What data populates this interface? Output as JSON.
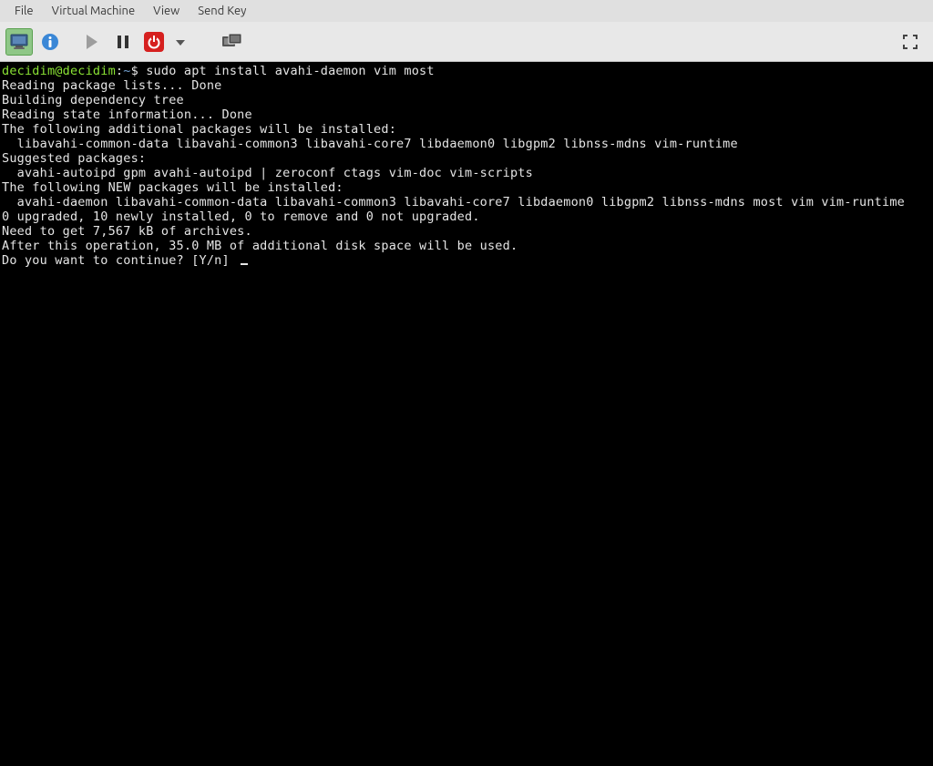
{
  "menubar": {
    "items": [
      "File",
      "Virtual Machine",
      "View",
      "Send Key"
    ]
  },
  "toolbar": {
    "monitor_icon": "monitor-icon",
    "info_icon": "info-icon",
    "play_icon": "play-icon",
    "pause_icon": "pause-icon",
    "power_icon": "power-icon",
    "dropdown_icon": "chevron-down-icon",
    "clone_icon": "clone-display-icon",
    "fullscreen_icon": "fullscreen-icon"
  },
  "terminal": {
    "prompt_user": "decidim@decidim",
    "prompt_sep": ":",
    "prompt_path": "~",
    "prompt_dollar": "$ ",
    "command": "sudo apt install avahi-daemon vim most",
    "lines": [
      "Reading package lists... Done",
      "Building dependency tree",
      "Reading state information... Done",
      "The following additional packages will be installed:",
      "  libavahi-common-data libavahi-common3 libavahi-core7 libdaemon0 libgpm2 libnss-mdns vim-runtime",
      "Suggested packages:",
      "  avahi-autoipd gpm avahi-autoipd | zeroconf ctags vim-doc vim-scripts",
      "The following NEW packages will be installed:",
      "  avahi-daemon libavahi-common-data libavahi-common3 libavahi-core7 libdaemon0 libgpm2 libnss-mdns most vim vim-runtime",
      "0 upgraded, 10 newly installed, 0 to remove and 0 not upgraded.",
      "Need to get 7,567 kB of archives.",
      "After this operation, 35.0 MB of additional disk space will be used.",
      "Do you want to continue? [Y/n] "
    ]
  }
}
